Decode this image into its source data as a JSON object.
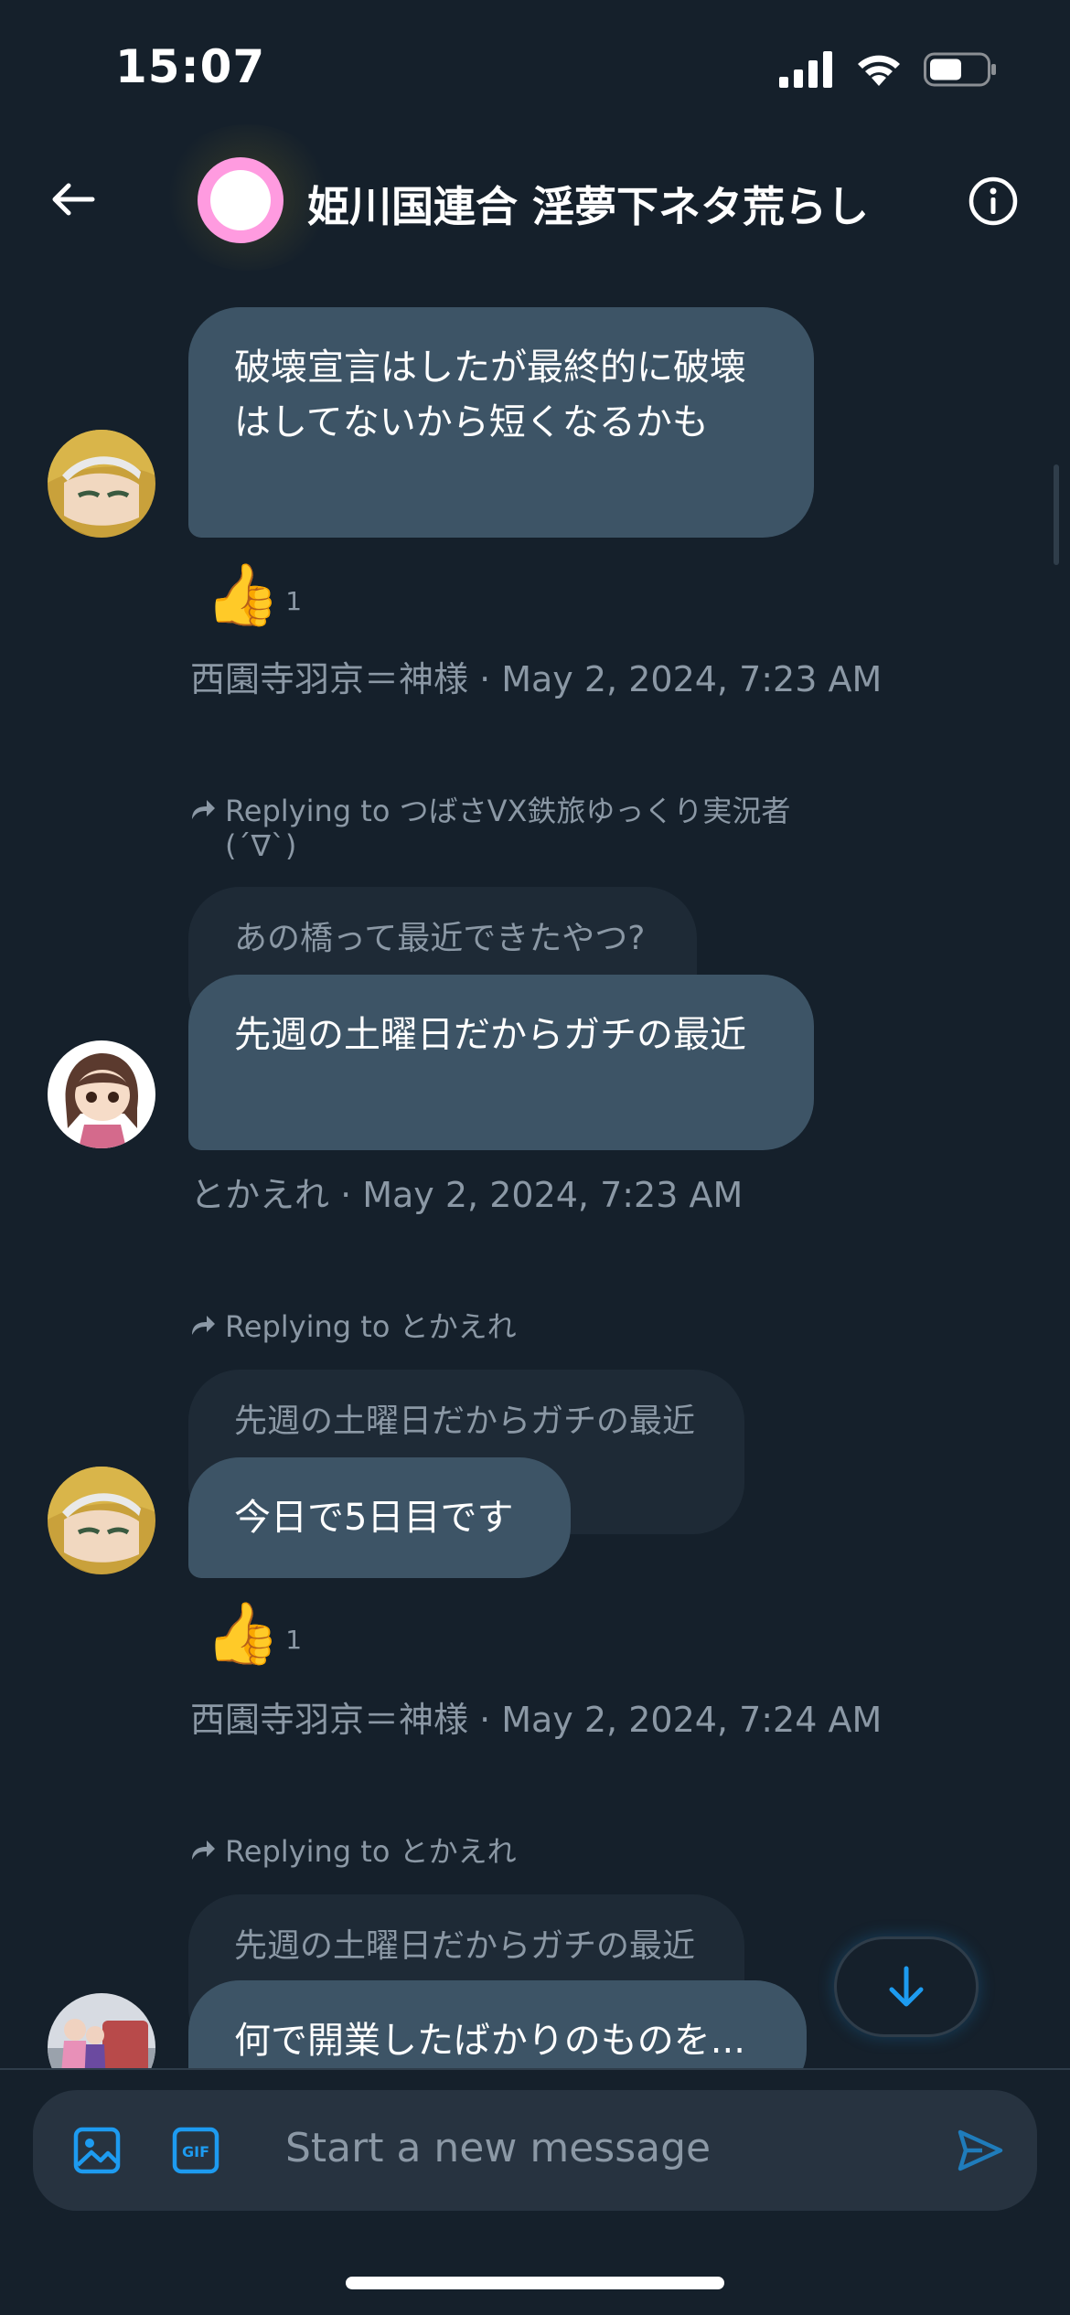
{
  "status_bar": {
    "time": "15:07"
  },
  "header": {
    "title": "姫川国連合 淫夢下ネタ荒らし"
  },
  "messages": [
    {
      "text": "破壊宣言はしたが最終的に破壊はしてないから短くなるかも",
      "reaction": {
        "emoji": "👍",
        "count": "1"
      },
      "meta": "西園寺羽京＝神様 · May 2, 2024, 7:23 AM"
    },
    {
      "reply_note": "Replying to つばさVX鉄旅ゆっくり実況者(´∇`)",
      "quoted": "あの橋って最近できたやつ?",
      "text": "先週の土曜日だからガチの最近",
      "meta": "とかえれ · May 2, 2024, 7:23 AM"
    },
    {
      "reply_note": "Replying to とかえれ",
      "quoted": "先週の土曜日だからガチの最近",
      "text": "今日で5日目です",
      "reaction": {
        "emoji": "👍",
        "count": "1"
      },
      "meta": "西園寺羽京＝神様 · May 2, 2024, 7:24 AM"
    },
    {
      "reply_note": "Replying to とかえれ",
      "quoted": "先週の土曜日だからガチの最近",
      "text": "何で開業したばかりのものを..."
    }
  ],
  "composer": {
    "placeholder": "Start a new message"
  },
  "colors": {
    "accent": "#1d9bf0",
    "background": "#15202b",
    "bubble": "#3d5466"
  }
}
